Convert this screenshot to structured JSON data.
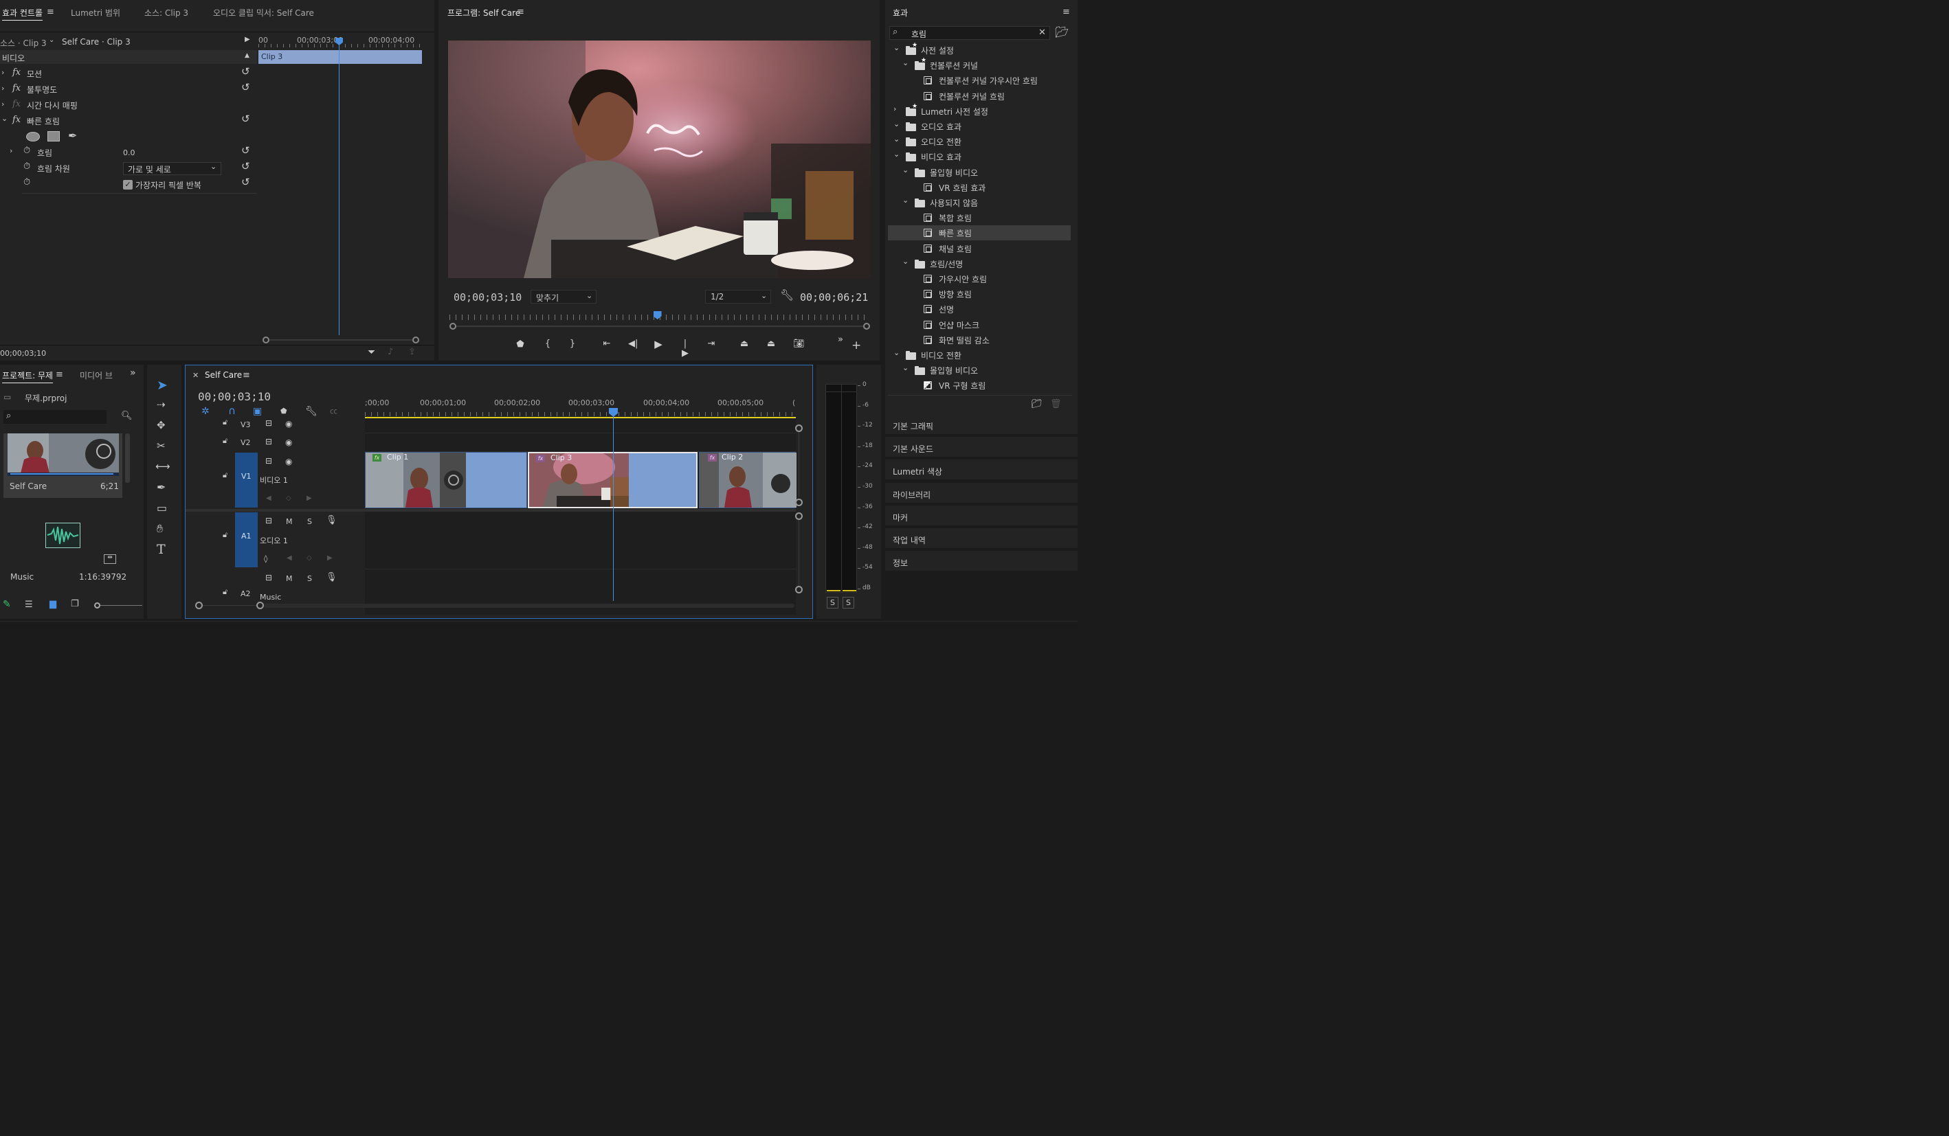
{
  "effect_controls": {
    "tabs": [
      "효과 컨트롤",
      "Lumetri 범위",
      "소스: Clip 3",
      "오디오 클립 믹서: Self Care"
    ],
    "source_label": "소스 · Clip 3",
    "sequence_label": "Self Care · Clip 3",
    "ruler": {
      "t0": "00",
      "t1": "00;00;03;00",
      "t2": "00;00;04;00"
    },
    "clip_label": "Clip 3",
    "section": "비디오",
    "effects": [
      "모션",
      "불투명도",
      "시간 다시 매핑",
      "빠른 흐림"
    ],
    "blur_label": "흐림",
    "blur_value": "0.0",
    "dimension_label": "흐림 차원",
    "dimension_value": "가로 및 세로",
    "repeat_edge_label": "가장자리 픽셀 반복",
    "timecode": "00;00;03;10"
  },
  "program": {
    "title": "프로그램: Self Care",
    "timecode": "00;00;03;10",
    "fit": "맞추기",
    "resolution": "1/2",
    "duration": "00;00;06;21",
    "playhead_fraction": 0.496
  },
  "effects_panel": {
    "title": "효과",
    "search_value": "흐림",
    "tree": [
      {
        "label": "사전 설정",
        "type": "folder-star",
        "level": 0,
        "exp": "v"
      },
      {
        "label": "컨볼루션 커널",
        "type": "folder-star",
        "level": 1,
        "exp": "v"
      },
      {
        "label": "컨볼루션 커널 가우시안 흐림",
        "type": "preset",
        "level": 2,
        "exp": ""
      },
      {
        "label": "컨볼루션 커널 흐림",
        "type": "preset",
        "level": 2,
        "exp": ""
      },
      {
        "label": "Lumetri 사전 설정",
        "type": "folder-star",
        "level": 0,
        "exp": ">"
      },
      {
        "label": "오디오 효과",
        "type": "folder",
        "level": 0,
        "exp": "v"
      },
      {
        "label": "오디오 전환",
        "type": "folder",
        "level": 0,
        "exp": "v"
      },
      {
        "label": "비디오 효과",
        "type": "folder",
        "level": 0,
        "exp": "v"
      },
      {
        "label": "몰입형 비디오",
        "type": "folder",
        "level": 1,
        "exp": "v"
      },
      {
        "label": "VR 흐림 효과",
        "type": "effect",
        "level": 2,
        "exp": ""
      },
      {
        "label": "사용되지 않음",
        "type": "folder",
        "level": 1,
        "exp": "v"
      },
      {
        "label": "복합 흐림",
        "type": "effect",
        "level": 2,
        "exp": ""
      },
      {
        "label": "빠른 흐림",
        "type": "effect",
        "level": 2,
        "exp": "",
        "selected": true
      },
      {
        "label": "채널 흐림",
        "type": "effect",
        "level": 2,
        "exp": ""
      },
      {
        "label": "흐림/선명",
        "type": "folder",
        "level": 1,
        "exp": "v"
      },
      {
        "label": "가우시안 흐림",
        "type": "effect",
        "level": 2,
        "exp": ""
      },
      {
        "label": "방향 흐림",
        "type": "effect",
        "level": 2,
        "exp": ""
      },
      {
        "label": "선명",
        "type": "effect",
        "level": 2,
        "exp": ""
      },
      {
        "label": "언샵 마스크",
        "type": "effect",
        "level": 2,
        "exp": ""
      },
      {
        "label": "화면 떨림 감소",
        "type": "effect",
        "level": 2,
        "exp": ""
      },
      {
        "label": "비디오 전환",
        "type": "folder",
        "level": 0,
        "exp": "v"
      },
      {
        "label": "몰입형 비디오",
        "type": "folder",
        "level": 1,
        "exp": "v"
      },
      {
        "label": "VR 구형 흐림",
        "type": "transition",
        "level": 2,
        "exp": ""
      }
    ],
    "stacked": [
      "기본 그래픽",
      "기본 사운드",
      "Lumetri 색상",
      "라이브러리",
      "마커",
      "작업 내역",
      "정보"
    ]
  },
  "project": {
    "tab": "프로젝트: 무제",
    "tab2": "미디어 브",
    "file": "무제.prproj",
    "items": [
      {
        "name": "Self Care",
        "duration": "6;21"
      },
      {
        "name": "Music",
        "duration": "1:16:39792"
      }
    ]
  },
  "timeline": {
    "title": "Self Care",
    "timecode": "00;00;03;10",
    "ruler": [
      ";00;00",
      "00;00;01;00",
      "00;00;02;00",
      "00;00;03;00",
      "00;00;04;00",
      "00;00;05;00"
    ],
    "video_tracks": [
      "V3",
      "V2",
      "V1"
    ],
    "v1_name": "비디오 1",
    "audio_tracks": [
      "A1",
      "A2"
    ],
    "a1_name": "오디오 1",
    "a2_name": "Music",
    "clips": [
      {
        "name": "Clip 1"
      },
      {
        "name": "Clip 3"
      },
      {
        "name": "Clip 2"
      }
    ],
    "buttons": {
      "mute": "M",
      "solo": "S"
    }
  },
  "meter": {
    "scale": [
      "0",
      "-6",
      "-12",
      "-18",
      "-24",
      "-30",
      "-36",
      "-42",
      "-48",
      "-54",
      "dB"
    ],
    "solo": [
      "S",
      "S"
    ]
  }
}
